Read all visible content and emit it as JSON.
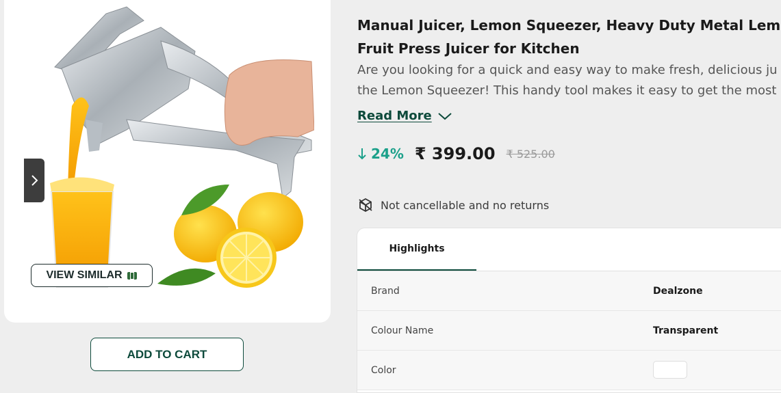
{
  "gallery": {
    "view_similar_label": "VIEW SIMILAR",
    "next_icon": "chevron-right-icon"
  },
  "actions": {
    "add_to_cart_label": "ADD TO CART"
  },
  "product": {
    "title_line1": "Manual Juicer, Lemon Squeezer, Heavy Duty Metal Lemon",
    "title_line2": "Fruit Press Juicer for Kitchen",
    "description_line1": "Are you looking for a quick and easy way to make fresh, delicious ju",
    "description_line2": "the Lemon Squeezer! This handy tool makes it easy to get the most",
    "read_more_label": "Read More",
    "discount": "24%",
    "price": "₹ 399.00",
    "mrp": "₹ 525.00",
    "return_policy": "Not cancellable and no returns"
  },
  "highlights": {
    "tab_label": "Highlights",
    "rows": [
      {
        "label": "Brand",
        "value": "Dealzone"
      },
      {
        "label": "Colour Name",
        "value": "Transparent"
      },
      {
        "label": "Color",
        "value": ""
      }
    ]
  },
  "colors": {
    "brand_green": "#0d4a3b",
    "discount_green": "#1ba08a",
    "background": "#eeeeee"
  }
}
